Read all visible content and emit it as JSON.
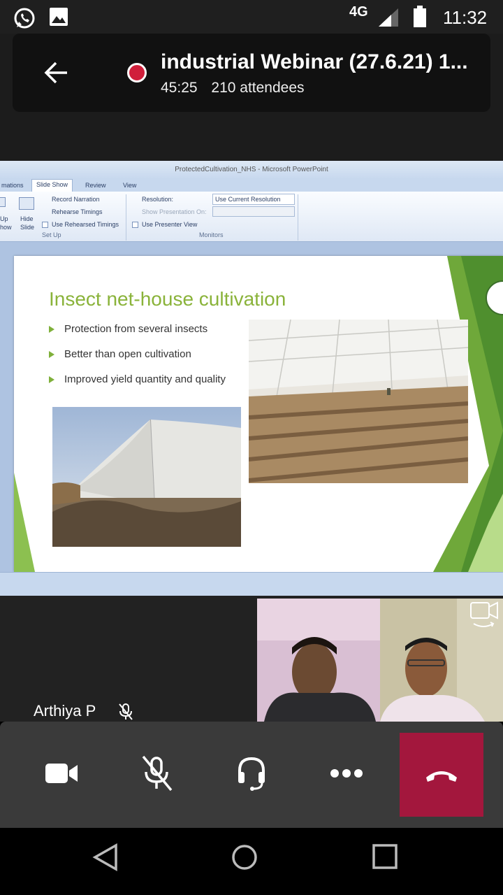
{
  "status_bar": {
    "network": "4G",
    "time": "11:32",
    "icons": [
      "whatsapp-icon",
      "gallery-icon",
      "signal-icon",
      "battery-icon"
    ]
  },
  "call": {
    "title": "industrial Webinar (27.6.21) 1...",
    "duration": "45:25",
    "attendees": "210 attendees",
    "recording_color": "#d01f3b"
  },
  "powerpoint": {
    "window_title": "ProtectedCultivation_NHS - Microsoft PowerPoint",
    "tabs": [
      "mations",
      "Slide Show",
      "Review",
      "View"
    ],
    "active_tab": "Slide Show",
    "ribbon": {
      "setup_left_labels": [
        "Up",
        "how"
      ],
      "hide_slide": [
        "Hide",
        "Slide"
      ],
      "record_narration": "Record Narration",
      "rehearse_timings": "Rehearse Timings",
      "use_rehearsed_timings": "Use Rehearsed Timings",
      "setup_group": "Set Up",
      "resolution_label": "Resolution:",
      "resolution_value": "Use Current Resolution",
      "show_presentation_on": "Show Presentation On:",
      "use_presenter_view": "Use Presenter View",
      "monitors_group": "Monitors"
    }
  },
  "slide": {
    "title": "Insect net-house cultivation",
    "bullets": [
      "Protection from several insects",
      "Better than open cultivation",
      "Improved yield quantity and quality"
    ],
    "accent_color": "#8ab33a"
  },
  "participants": {
    "featured_name": "Arthiya P",
    "featured_muted": true
  },
  "controls": {
    "items": [
      "video-camera-icon",
      "mic-off-icon",
      "headset-icon",
      "more-options-icon",
      "hang-up-icon"
    ],
    "hangup_color": "#a3173d"
  }
}
